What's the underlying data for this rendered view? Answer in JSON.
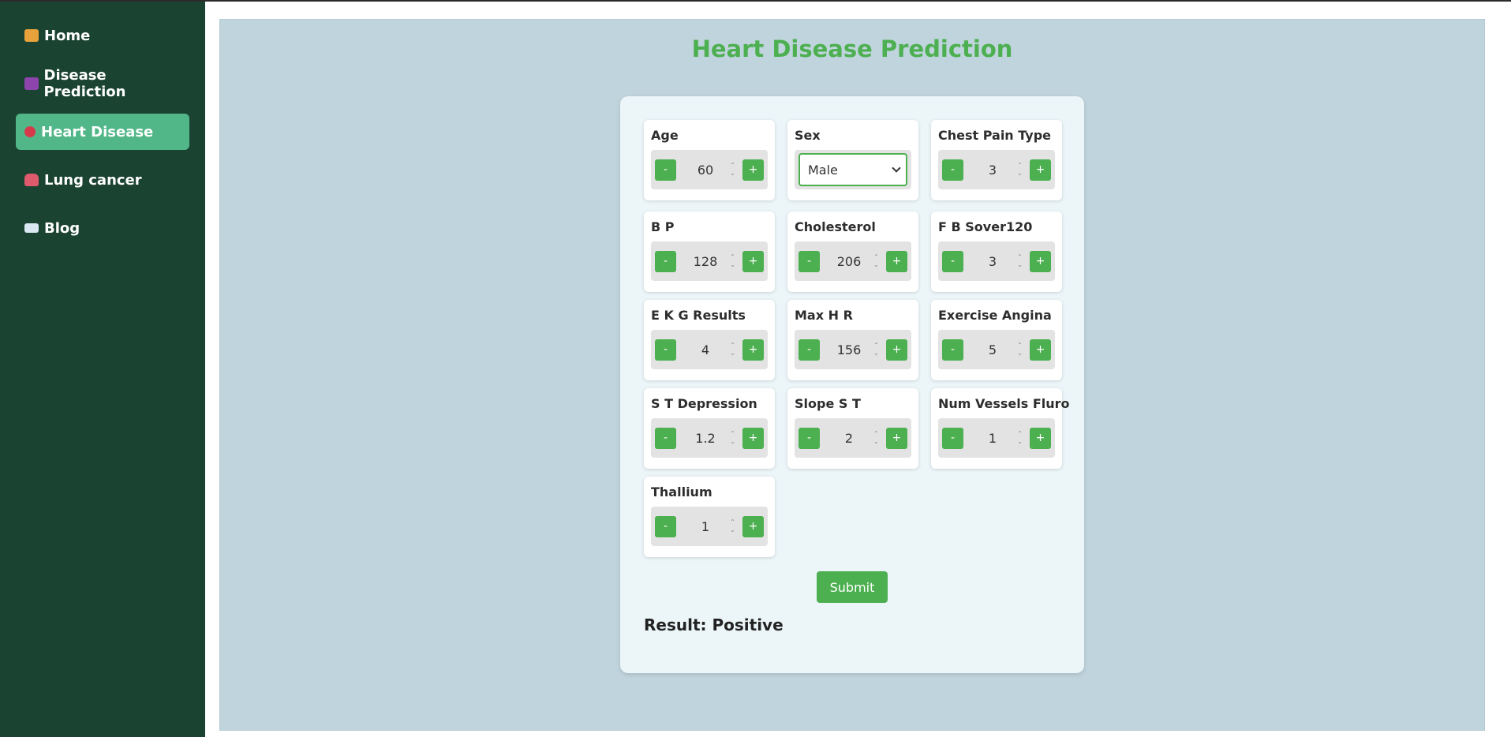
{
  "sidebar": {
    "items": [
      {
        "label": "Home",
        "icon": "home-icon",
        "icon_color": "#e8a23c"
      },
      {
        "label": "Disease Prediction",
        "icon": "medical-icon",
        "icon_color": "#8e44ad"
      },
      {
        "label": "Heart Disease",
        "icon": "heart-icon",
        "icon_color": "#d63a4a",
        "active": true
      },
      {
        "label": "Lung cancer",
        "icon": "lungs-icon",
        "icon_color": "#e05a6e"
      },
      {
        "label": "Blog",
        "icon": "book-icon",
        "icon_color": "#d9e8f2"
      }
    ]
  },
  "main": {
    "title": "Heart Disease Prediction",
    "fields": [
      {
        "label": "Age",
        "value": "60"
      },
      {
        "label": "Sex",
        "value": "Male"
      },
      {
        "label": "Chest Pain Type",
        "value": "3"
      },
      {
        "label": "B P",
        "value": "128"
      },
      {
        "label": "Cholesterol",
        "value": "206"
      },
      {
        "label": "F B Sover120",
        "value": "3"
      },
      {
        "label": "E K G Results",
        "value": "4"
      },
      {
        "label": "Max H R",
        "value": "156"
      },
      {
        "label": "Exercise Angina",
        "value": "5"
      },
      {
        "label": "S T Depression",
        "value": "1.2"
      },
      {
        "label": "Slope S T",
        "value": "2"
      },
      {
        "label": "Num Vessels Fluro",
        "value": "1"
      },
      {
        "label": "Thallium",
        "value": "1"
      }
    ],
    "stepper": {
      "minus": "-",
      "plus": "+"
    },
    "submit_label": "Submit",
    "result_text": "Result: Positive"
  },
  "colors": {
    "sidebar_bg": "#1b4332",
    "active_item": "#52b788",
    "accent": "#4caf50",
    "main_bg": "#c0d4dd",
    "card_bg": "#ecf6f9"
  }
}
